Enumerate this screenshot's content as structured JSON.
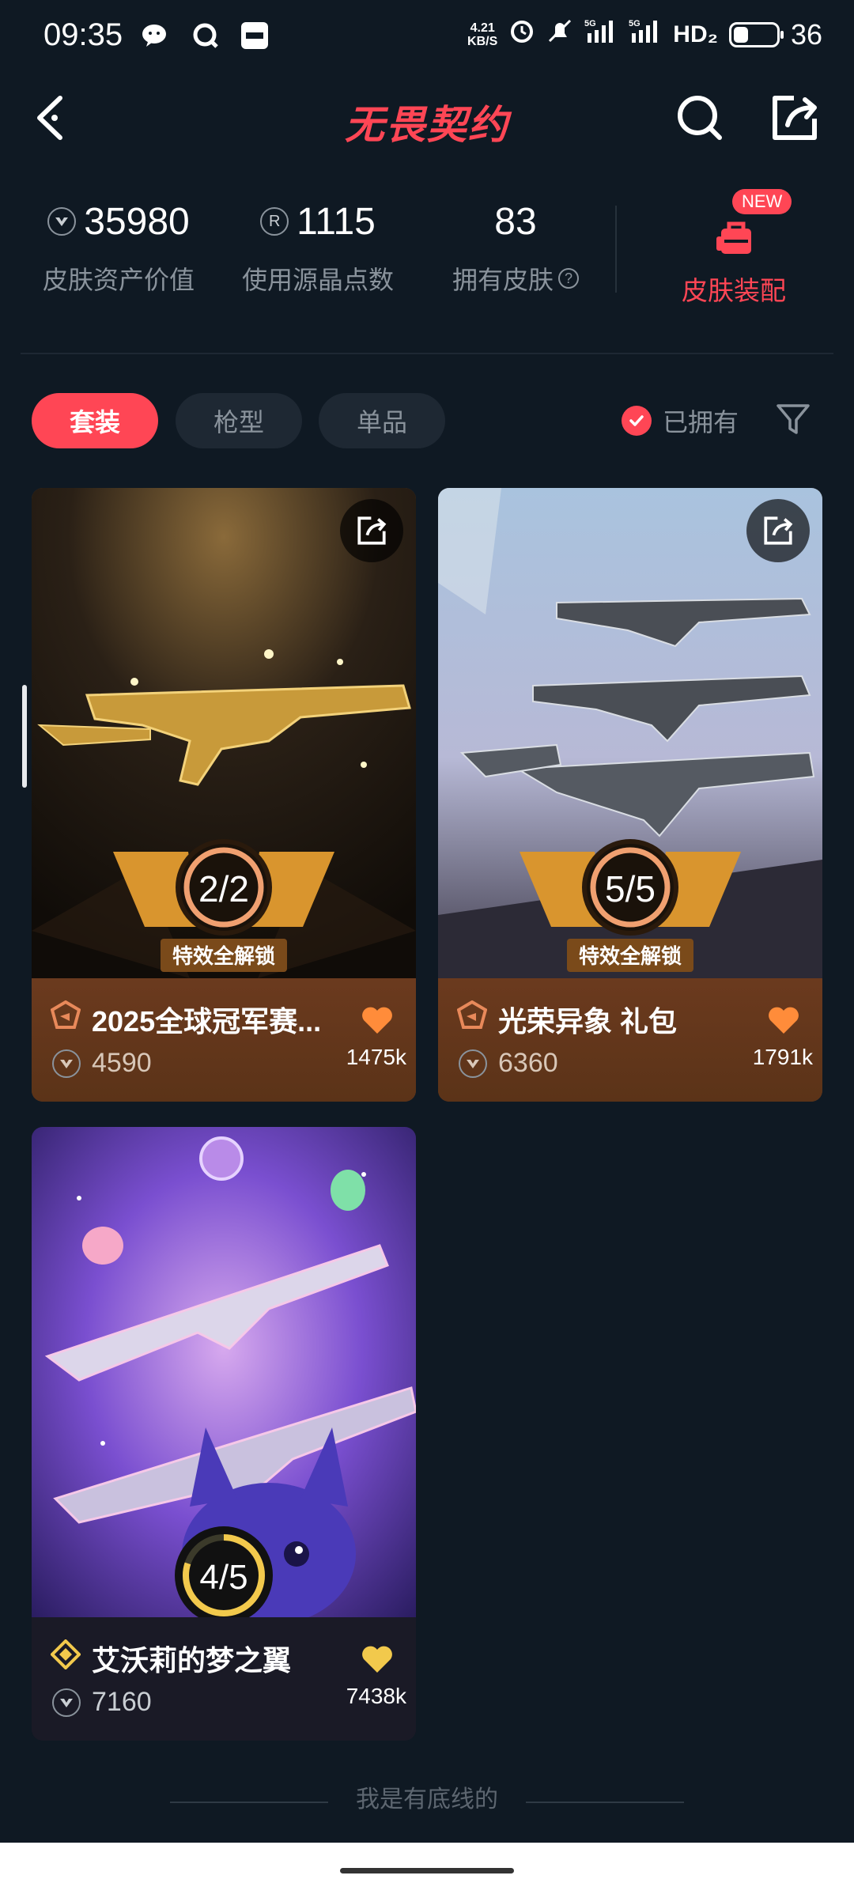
{
  "status_bar": {
    "time": "09:35",
    "net_speed_top": "4.21",
    "net_speed_bottom": "KB/S",
    "signal1": "5G",
    "signal2": "5G",
    "hd": "HD₂",
    "battery_level": "36"
  },
  "nav": {
    "title": "无畏契约",
    "icons": [
      "back-arrow-icon",
      "search-icon",
      "share-icon"
    ]
  },
  "stats": {
    "asset_value": "35980",
    "asset_label": "皮肤资产价值",
    "radianite": "1115",
    "radianite_label": "使用源晶点数",
    "owned_count": "83",
    "owned_label": "拥有皮肤",
    "equip_badge": "NEW",
    "equip_label": "皮肤装配"
  },
  "filters": {
    "tabs": [
      "套装",
      "枪型",
      "单品"
    ],
    "active_tab": "套装",
    "owned_label": "已拥有"
  },
  "cards": [
    {
      "name": "2025全球冠军赛...",
      "price": "4590",
      "likes": "1475k",
      "progress": "2/2",
      "progress_owned": 2,
      "progress_total": 2,
      "unlock_label": "特效全解锁",
      "tier_color": "#e8895a",
      "heart_color": "#ff8c3a"
    },
    {
      "name": "光荣异象 礼包",
      "price": "6360",
      "likes": "1791k",
      "progress": "5/5",
      "progress_owned": 5,
      "progress_total": 5,
      "unlock_label": "特效全解锁",
      "tier_color": "#e8895a",
      "heart_color": "#ff8c3a"
    },
    {
      "name": "艾沃莉的梦之翼",
      "price": "7160",
      "likes": "7438k",
      "progress": "4/5",
      "progress_owned": 4,
      "progress_total": 5,
      "tier_color": "#f2c94c",
      "heart_color": "#f2c94c"
    }
  ],
  "footer": {
    "text": "我是有底线的"
  }
}
